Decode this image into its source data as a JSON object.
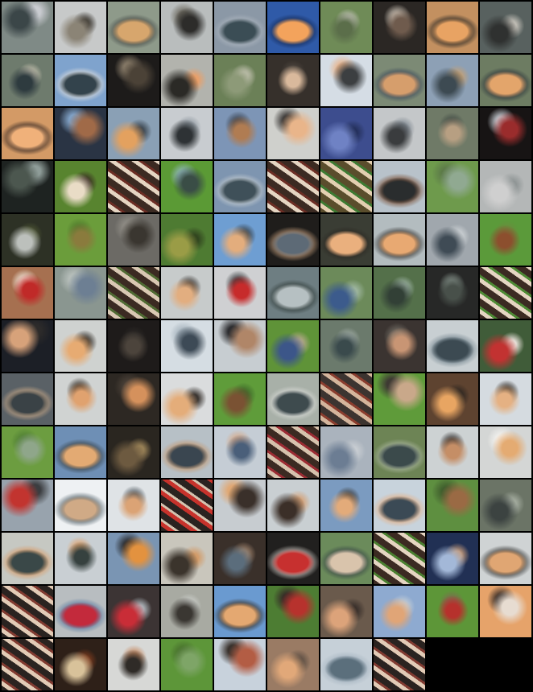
{
  "image": {
    "description_free": true,
    "columns": 10,
    "tile_count": 128,
    "background": "#000000",
    "tiles": [
      {
        "bg": "#7f8a86",
        "fg": "#3b4648",
        "ac": "#c9cbd0",
        "kind": "blob"
      },
      {
        "bg": "#c7c9c9",
        "fg": "#8b8476",
        "ac": "#3a3630",
        "kind": "blob"
      },
      {
        "bg": "#8e9a8a",
        "fg": "#d7a66d",
        "ac": "#4a4f4b",
        "kind": "cloud"
      },
      {
        "bg": "#b9bdbd",
        "fg": "#2d2c2a",
        "ac": "#6e6b61",
        "kind": "blob"
      },
      {
        "bg": "#8b98a6",
        "fg": "#3b4d55",
        "ac": "#aab3bd",
        "kind": "cloud"
      },
      {
        "bg": "#2f5aa8",
        "fg": "#f3a35c",
        "ac": "#162d5c",
        "kind": "cloud"
      },
      {
        "bg": "#6f8b57",
        "fg": "#5b6e4a",
        "ac": "#c5c3bb",
        "kind": "blob"
      },
      {
        "bg": "#2b2724",
        "fg": "#6f5b4d",
        "ac": "#c8bfb3",
        "kind": "blob"
      },
      {
        "bg": "#c39060",
        "fg": "#e8a363",
        "ac": "#2d2a26",
        "kind": "cloud"
      },
      {
        "bg": "#58615f",
        "fg": "#2f3130",
        "ac": "#c2bfb7",
        "kind": "blob"
      },
      {
        "bg": "#6e7b6d",
        "fg": "#2e3b3f",
        "ac": "#c8c3b1",
        "kind": "blob"
      },
      {
        "bg": "#7fa3cd",
        "fg": "#33434c",
        "ac": "#d8dadb",
        "kind": "cloud"
      },
      {
        "bg": "#1d1b1a",
        "fg": "#4b4237",
        "ac": "#8b7e6b",
        "kind": "blob"
      },
      {
        "bg": "#b2b3ad",
        "fg": "#2b2a26",
        "ac": "#e8a06a",
        "kind": "blob"
      },
      {
        "bg": "#6b8057",
        "fg": "#8d9a78",
        "ac": "#c4c3b2",
        "kind": "blob"
      },
      {
        "bg": "#36302b",
        "fg": "#d9b99c",
        "ac": "#4f4740",
        "kind": "blob"
      },
      {
        "bg": "#d5dde5",
        "fg": "#3c3f41",
        "ac": "#e8b38a",
        "kind": "blob"
      },
      {
        "bg": "#7c8a75",
        "fg": "#d69e6c",
        "ac": "#3e4c5c",
        "kind": "cloud"
      },
      {
        "bg": "#8da0b5",
        "fg": "#3d4a52",
        "ac": "#c3a076",
        "kind": "blob"
      },
      {
        "bg": "#6d7c62",
        "fg": "#e3a56b",
        "ac": "#30383c",
        "kind": "cloud"
      },
      {
        "bg": "#d39a66",
        "fg": "#f0b17a",
        "ac": "#3b2c26",
        "kind": "cloud"
      },
      {
        "bg": "#2a3444",
        "fg": "#a06a48",
        "ac": "#7fa0c4",
        "kind": "blob"
      },
      {
        "bg": "#8aa0b5",
        "fg": "#e3a15f",
        "ac": "#3c4650",
        "kind": "blob"
      },
      {
        "bg": "#c8ccd0",
        "fg": "#2e3235",
        "ac": "#8f98a0",
        "kind": "blob"
      },
      {
        "bg": "#7d95b6",
        "fg": "#b07c52",
        "ac": "#3a4350",
        "kind": "blob"
      },
      {
        "bg": "#cfd0cc",
        "fg": "#e9b58a",
        "ac": "#3b3836",
        "kind": "blob"
      },
      {
        "bg": "#3d4d8e",
        "fg": "#6f82c4",
        "ac": "#24305c",
        "kind": "blob"
      },
      {
        "bg": "#c4c7c9",
        "fg": "#3a3c3e",
        "ac": "#7e8790",
        "kind": "blob"
      },
      {
        "bg": "#6f7a67",
        "fg": "#b79f82",
        "ac": "#414a44",
        "kind": "blob"
      },
      {
        "bg": "#171414",
        "fg": "#9a2c2c",
        "ac": "#c6cbd2",
        "kind": "blob"
      },
      {
        "bg": "#1e2321",
        "fg": "#4c574f",
        "ac": "#8e9c98",
        "kind": "blob"
      },
      {
        "bg": "#58842f",
        "fg": "#e9dcc6",
        "ac": "#3a2c22",
        "kind": "blob"
      },
      {
        "bg": "#3b2a22",
        "fg": "#e5d5c2",
        "ac": "#6b2d24",
        "kind": "stripe"
      },
      {
        "bg": "#5b9a35",
        "fg": "#3a4d46",
        "ac": "#8fb6b8",
        "kind": "blob"
      },
      {
        "bg": "#7e95b0",
        "fg": "#3f5059",
        "ac": "#bfc8ce",
        "kind": "cloud"
      },
      {
        "bg": "#3b2a22",
        "fg": "#e5d5c2",
        "ac": "#6b2d24",
        "kind": "stripe"
      },
      {
        "bg": "#5a4d2c",
        "fg": "#e3cfb1",
        "ac": "#3d7a32",
        "kind": "stripe"
      },
      {
        "bg": "#b8c2ca",
        "fg": "#2a2d2e",
        "ac": "#7f5942",
        "kind": "cloud"
      },
      {
        "bg": "#6e9a4c",
        "fg": "#90a991",
        "ac": "#5c7a48",
        "kind": "blob"
      },
      {
        "bg": "#b4b7b7",
        "fg": "#cfcfcf",
        "ac": "#8e9494",
        "kind": "blob"
      },
      {
        "bg": "#2d3125",
        "fg": "#bcc0bc",
        "ac": "#4c5433",
        "kind": "blob"
      },
      {
        "bg": "#6b9d3b",
        "fg": "#8a7b3d",
        "ac": "#4f7a2c",
        "kind": "blob"
      },
      {
        "bg": "#6c6a65",
        "fg": "#3a3630",
        "ac": "#908d86",
        "kind": "blob"
      },
      {
        "bg": "#4e7b32",
        "fg": "#9a9c46",
        "ac": "#31451f",
        "kind": "blob"
      },
      {
        "bg": "#6e9ed2",
        "fg": "#e3ad7d",
        "ac": "#39424a",
        "kind": "blob"
      },
      {
        "bg": "#1f1d1b",
        "fg": "#5d6a76",
        "ac": "#b08e70",
        "kind": "cloud"
      },
      {
        "bg": "#3a3d34",
        "fg": "#eab07e",
        "ac": "#2d2a24",
        "kind": "cloud"
      },
      {
        "bg": "#b3bcbf",
        "fg": "#e8a972",
        "ac": "#3b3a38",
        "kind": "cloud"
      },
      {
        "bg": "#a0a7ad",
        "fg": "#3f4b55",
        "ac": "#cfd4d7",
        "kind": "blob"
      },
      {
        "bg": "#5b9a3a",
        "fg": "#8c4f2e",
        "ac": "#6b8b3d",
        "kind": "blob"
      },
      {
        "bg": "#a67050",
        "fg": "#c02a28",
        "ac": "#efe3d6",
        "kind": "blob"
      },
      {
        "bg": "#8a9690",
        "fg": "#6d7f93",
        "ac": "#b5bdb9",
        "kind": "blob"
      },
      {
        "bg": "#3b2a22",
        "fg": "#d9c8b3",
        "ac": "#4f6a33",
        "kind": "stripe"
      },
      {
        "bg": "#c7cbcb",
        "fg": "#e2ae80",
        "ac": "#3a3633",
        "kind": "blob"
      },
      {
        "bg": "#cfd0d2",
        "fg": "#c72b2b",
        "ac": "#3a3d40",
        "kind": "blob"
      },
      {
        "bg": "#6e7e82",
        "fg": "#b6c0c2",
        "ac": "#35413f",
        "kind": "cloud"
      },
      {
        "bg": "#6c8a5a",
        "fg": "#3c5b8c",
        "ac": "#9cb49c",
        "kind": "blob"
      },
      {
        "bg": "#54704a",
        "fg": "#324036",
        "ac": "#9fb4a6",
        "kind": "blob"
      },
      {
        "bg": "#272827",
        "fg": "#48504a",
        "ac": "#7e8a83",
        "kind": "blob"
      },
      {
        "bg": "#3b2a22",
        "fg": "#e5d5c2",
        "ac": "#4d8a34",
        "kind": "stripe"
      },
      {
        "bg": "#1c1f26",
        "fg": "#d7a27a",
        "ac": "#2d2b2a",
        "kind": "blob"
      },
      {
        "bg": "#cfd2d0",
        "fg": "#e7ab72",
        "ac": "#3b3630",
        "kind": "blob"
      },
      {
        "bg": "#1e1b1a",
        "fg": "#4c443c",
        "ac": "#2d2a27",
        "kind": "blob"
      },
      {
        "bg": "#d5dde3",
        "fg": "#3d4a56",
        "ac": "#a5b2bc",
        "kind": "blob"
      },
      {
        "bg": "#c7cdd1",
        "fg": "#b08668",
        "ac": "#2d2d30",
        "kind": "blob"
      },
      {
        "bg": "#5f9338",
        "fg": "#3c5689",
        "ac": "#b4a88a",
        "kind": "blob"
      },
      {
        "bg": "#6b7a6c",
        "fg": "#3a4a4c",
        "ac": "#a2ada7",
        "kind": "blob"
      },
      {
        "bg": "#3b3431",
        "fg": "#c89574",
        "ac": "#6f6a62",
        "kind": "blob"
      },
      {
        "bg": "#c8cfd2",
        "fg": "#3c4a52",
        "ac": "#7a8a93",
        "kind": "cloud"
      },
      {
        "bg": "#405c39",
        "fg": "#c23231",
        "ac": "#e8e2da",
        "kind": "blob"
      },
      {
        "bg": "#5a6166",
        "fg": "#3a4246",
        "ac": "#c0a385",
        "kind": "cloud"
      },
      {
        "bg": "#d0d3d2",
        "fg": "#e0a26f",
        "ac": "#3a332c",
        "kind": "blob"
      },
      {
        "bg": "#2d2823",
        "fg": "#d5915c",
        "ac": "#4a4037",
        "kind": "blob"
      },
      {
        "bg": "#dadcdd",
        "fg": "#e4ad7a",
        "ac": "#3c3733",
        "kind": "blob"
      },
      {
        "bg": "#5f9c3a",
        "fg": "#7a5233",
        "ac": "#3f6a2a",
        "kind": "blob"
      },
      {
        "bg": "#a8b0a8",
        "fg": "#3e4b4e",
        "ac": "#d6d8d4",
        "kind": "cloud"
      },
      {
        "bg": "#3c3430",
        "fg": "#d4b59c",
        "ac": "#8a3d2e",
        "kind": "stripe"
      },
      {
        "bg": "#5f9b3a",
        "fg": "#c9a88a",
        "ac": "#3e3a33",
        "kind": "blob"
      },
      {
        "bg": "#5e4330",
        "fg": "#e8a562",
        "ac": "#2c2520",
        "kind": "blob"
      },
      {
        "bg": "#d5dbe0",
        "fg": "#e5b183",
        "ac": "#35302b",
        "kind": "blob"
      },
      {
        "bg": "#6c9d40",
        "fg": "#8fa68a",
        "ac": "#4e7d33",
        "kind": "blob"
      },
      {
        "bg": "#6e8fb5",
        "fg": "#e3aa73",
        "ac": "#3a444a",
        "kind": "cloud"
      },
      {
        "bg": "#2a2620",
        "fg": "#6d5a40",
        "ac": "#9c8458",
        "kind": "blob"
      },
      {
        "bg": "#b7c0c6",
        "fg": "#3a4650",
        "ac": "#c39a74",
        "kind": "cloud"
      },
      {
        "bg": "#c5cdd5",
        "fg": "#4a5f7a",
        "ac": "#d7a987",
        "kind": "blob"
      },
      {
        "bg": "#3b2a22",
        "fg": "#d6c2ad",
        "ac": "#9b2b33",
        "kind": "stripe"
      },
      {
        "bg": "#aab3bd",
        "fg": "#6c7d93",
        "ac": "#c8cdd2",
        "kind": "blob"
      },
      {
        "bg": "#6d8455",
        "fg": "#3b4a4b",
        "ac": "#a7b39b",
        "kind": "cloud"
      },
      {
        "bg": "#cdd2d3",
        "fg": "#c58e66",
        "ac": "#333131",
        "kind": "blob"
      },
      {
        "bg": "#d4d6d5",
        "fg": "#e4ab72",
        "ac": "#f3f2ef",
        "kind": "blob"
      },
      {
        "bg": "#98a3ad",
        "fg": "#c2342f",
        "ac": "#3b3d40",
        "kind": "blob"
      },
      {
        "bg": "#eef1f3",
        "fg": "#d0aa86",
        "ac": "#5a6870",
        "kind": "cloud"
      },
      {
        "bg": "#dfe3e6",
        "fg": "#dba375",
        "ac": "#4a535a",
        "kind": "blob"
      },
      {
        "bg": "#2a2320",
        "fg": "#c7322b",
        "ac": "#d3c3af",
        "kind": "stripe"
      },
      {
        "bg": "#c7ccd0",
        "fg": "#3a302a",
        "ac": "#e0a874",
        "kind": "blob"
      },
      {
        "bg": "#c9cfd2",
        "fg": "#3b2f28",
        "ac": "#d4a37a",
        "kind": "blob"
      },
      {
        "bg": "#7b9bc0",
        "fg": "#e3ab7a",
        "ac": "#3c3a38",
        "kind": "blob"
      },
      {
        "bg": "#c8d3dc",
        "fg": "#3b4a55",
        "ac": "#e3b38c",
        "kind": "cloud"
      },
      {
        "bg": "#5e8f40",
        "fg": "#9a6a44",
        "ac": "#405e2d",
        "kind": "blob"
      },
      {
        "bg": "#6b7466",
        "fg": "#3c4341",
        "ac": "#a3ab9e",
        "kind": "blob"
      },
      {
        "bg": "#c6c8c2",
        "fg": "#3a4848",
        "ac": "#d8a070",
        "kind": "cloud"
      },
      {
        "bg": "#c9cfd3",
        "fg": "#36413f",
        "ac": "#e1a46f",
        "kind": "blob"
      },
      {
        "bg": "#7a95b3",
        "fg": "#e3923f",
        "ac": "#2a2c30",
        "kind": "blob"
      },
      {
        "bg": "#c9c6bc",
        "fg": "#3b342c",
        "ac": "#d29c6a",
        "kind": "blob"
      },
      {
        "bg": "#3a302a",
        "fg": "#5b6d7c",
        "ac": "#9b806a",
        "kind": "blob"
      },
      {
        "bg": "#21201f",
        "fg": "#c7302f",
        "ac": "#b8b3ae",
        "kind": "cloud"
      },
      {
        "bg": "#6b8b5b",
        "fg": "#d9c4ac",
        "ac": "#3c4b47",
        "kind": "cloud"
      },
      {
        "bg": "#3b2a22",
        "fg": "#e5d5c2",
        "ac": "#4a7f30",
        "kind": "stripe"
      },
      {
        "bg": "#213054",
        "fg": "#a3b8d8",
        "ac": "#c49a7a",
        "kind": "blob"
      },
      {
        "bg": "#cfd3d4",
        "fg": "#e0a673",
        "ac": "#3b3c3b",
        "kind": "cloud"
      },
      {
        "bg": "#2a2320",
        "fg": "#e2cbb6",
        "ac": "#803a30",
        "kind": "stripe"
      },
      {
        "bg": "#b8bdc0",
        "fg": "#c32a3c",
        "ac": "#5f7fa3",
        "kind": "cloud"
      },
      {
        "bg": "#3c3434",
        "fg": "#c92d37",
        "ac": "#aeb5bb",
        "kind": "blob"
      },
      {
        "bg": "#a8aaa2",
        "fg": "#3a3732",
        "ac": "#cdd0cc",
        "kind": "blob"
      },
      {
        "bg": "#6a9ad0",
        "fg": "#e4a871",
        "ac": "#3a3530",
        "kind": "cloud"
      },
      {
        "bg": "#4d7d33",
        "fg": "#b7322d",
        "ac": "#362c27",
        "kind": "blob"
      },
      {
        "bg": "#6a5a4c",
        "fg": "#dca37a",
        "ac": "#3a302b",
        "kind": "blob"
      },
      {
        "bg": "#8eaad0",
        "fg": "#e0a577",
        "ac": "#c5ced6",
        "kind": "blob"
      },
      {
        "bg": "#5d9638",
        "fg": "#b6312c",
        "ac": "#7e6a4f",
        "kind": "blob"
      },
      {
        "bg": "#e6a36a",
        "fg": "#e7dcd1",
        "ac": "#3a2f29",
        "kind": "blob"
      },
      {
        "bg": "#2a2320",
        "fg": "#e2cbb6",
        "ac": "#803a30",
        "kind": "stripe"
      },
      {
        "bg": "#2e2018",
        "fg": "#d8c29a",
        "ac": "#7a3a1e",
        "kind": "blob"
      },
      {
        "bg": "#d7d8d6",
        "fg": "#2f2b27",
        "ac": "#c78a62",
        "kind": "blob"
      },
      {
        "bg": "#5d9639",
        "fg": "#7ea567",
        "ac": "#466e2c",
        "kind": "blob"
      },
      {
        "bg": "#c8d2dc",
        "fg": "#b35d44",
        "ac": "#3a332e",
        "kind": "blob"
      },
      {
        "bg": "#9a7b64",
        "fg": "#e1a879",
        "ac": "#5d4f44",
        "kind": "blob"
      },
      {
        "bg": "#c6d0d8",
        "fg": "#5b6f7c",
        "ac": "#a8b6c2",
        "kind": "cloud"
      },
      {
        "bg": "#2a2320",
        "fg": "#e2cbb6",
        "ac": "#803a30",
        "kind": "stripe"
      }
    ]
  }
}
